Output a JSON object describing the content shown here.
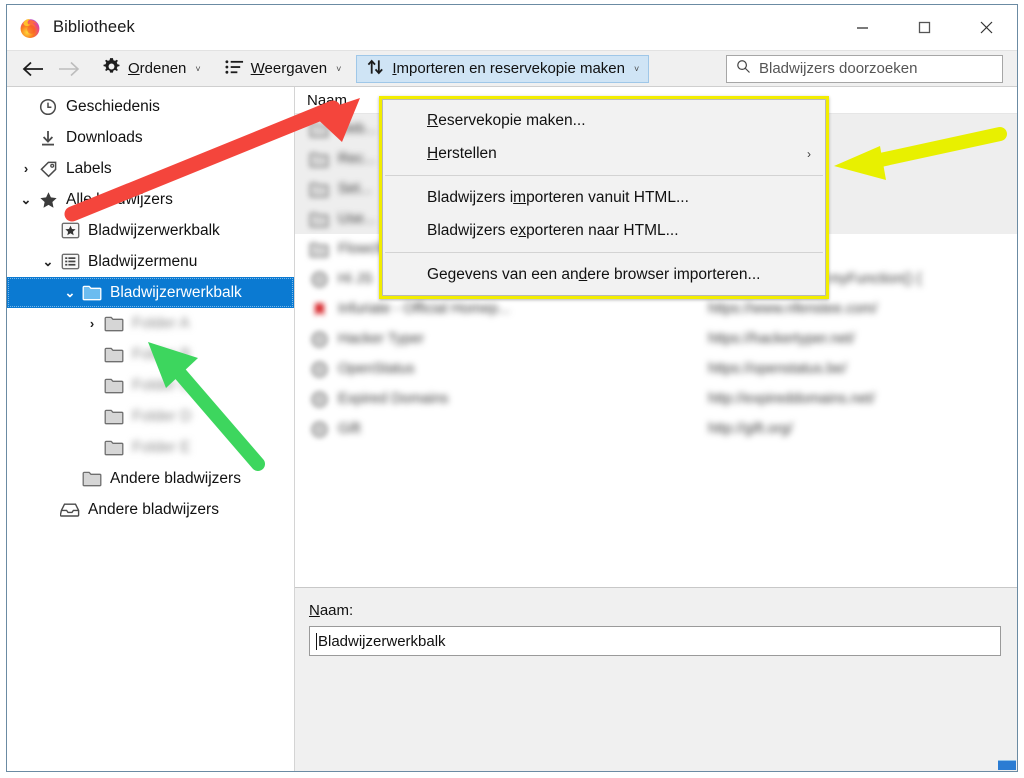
{
  "window": {
    "title": "Bibliotheek",
    "app_icon": "firefox-icon",
    "controls": {
      "minimize_label": "—",
      "maximize_label": "☐",
      "close_label": "✕"
    }
  },
  "toolbar": {
    "back_label": "←",
    "forward_label": "→",
    "organize": {
      "label_pre": "",
      "label_accel": "O",
      "label_post": "rdenen",
      "icon": "gear-icon",
      "caret": "˅"
    },
    "views": {
      "label_pre": "",
      "label_accel": "W",
      "label_post": "eergaven",
      "icon": "views-list-icon",
      "caret": "˅"
    },
    "import": {
      "label_pre": "",
      "label_accel": "I",
      "label_post": "mporteren en reservekopie maken",
      "icon": "import-export-icon",
      "caret": "˅"
    }
  },
  "search": {
    "icon": "search-icon",
    "placeholder": "Bladwijzers doorzoeken",
    "value": ""
  },
  "menu": {
    "border_color": "#f2ed00",
    "items": [
      {
        "pre": "",
        "accel": "R",
        "post": "eservekopie maken...",
        "type": "item",
        "name": "menu-item-backup"
      },
      {
        "pre": "",
        "accel": "H",
        "post": "erstellen",
        "type": "submenu",
        "arrow": "›",
        "name": "menu-item-restore"
      },
      {
        "type": "separator"
      },
      {
        "pre": "Bladwijzers i",
        "accel": "m",
        "post": "porteren vanuit HTML...",
        "type": "item",
        "name": "menu-item-import-html"
      },
      {
        "pre": "Bladwijzers e",
        "accel": "x",
        "post": "porteren naar HTML...",
        "type": "item",
        "name": "menu-item-export-html"
      },
      {
        "type": "separator"
      },
      {
        "pre": "Gegevens van een an",
        "accel": "d",
        "post": "ere browser importeren...",
        "type": "item",
        "name": "menu-item-import-other-browser"
      }
    ]
  },
  "sidebar": {
    "items": [
      {
        "label": "Geschiedenis",
        "icon": "clock-icon",
        "indent": 0,
        "twisty": "",
        "selected": false,
        "blurred": false,
        "name": "sidebar-item-history"
      },
      {
        "label": "Downloads",
        "icon": "download-icon",
        "indent": 0,
        "twisty": "",
        "selected": false,
        "blurred": false,
        "name": "sidebar-item-downloads"
      },
      {
        "label": "Labels",
        "icon": "tag-icon",
        "indent": 0,
        "twisty": "›",
        "selected": false,
        "blurred": false,
        "name": "sidebar-item-tags"
      },
      {
        "label": "Alle bladwijzers",
        "icon": "star-icon",
        "indent": 0,
        "twisty": "⌄",
        "selected": false,
        "blurred": false,
        "name": "sidebar-item-all-bookmarks"
      },
      {
        "label": "Bladwijzerwerkbalk",
        "icon": "star-box-icon",
        "indent": 1,
        "twisty": "",
        "selected": false,
        "blurred": false,
        "name": "sidebar-item-bookmarks-toolbar-top"
      },
      {
        "label": "Bladwijzermenu",
        "icon": "menu-list-icon",
        "indent": 1,
        "twisty": "⌄",
        "selected": false,
        "blurred": false,
        "name": "sidebar-item-bookmarks-menu"
      },
      {
        "label": "Bladwijzerwerkbalk",
        "icon": "folder-blue-icon",
        "indent": 2,
        "twisty": "⌄",
        "selected": true,
        "blurred": false,
        "name": "sidebar-item-bookmarks-toolbar-selected"
      },
      {
        "label": "Folder A",
        "icon": "folder-icon",
        "indent": 3,
        "twisty": "›",
        "selected": false,
        "blurred": true,
        "name": "sidebar-item-folder-1"
      },
      {
        "label": "Folder B",
        "icon": "folder-icon",
        "indent": 3,
        "twisty": "",
        "selected": false,
        "blurred": true,
        "name": "sidebar-item-folder-2"
      },
      {
        "label": "Folder C",
        "icon": "folder-icon",
        "indent": 3,
        "twisty": "",
        "selected": false,
        "blurred": true,
        "name": "sidebar-item-folder-3"
      },
      {
        "label": "Folder D",
        "icon": "folder-icon",
        "indent": 3,
        "twisty": "",
        "selected": false,
        "blurred": true,
        "name": "sidebar-item-folder-4"
      },
      {
        "label": "Folder E",
        "icon": "folder-icon",
        "indent": 3,
        "twisty": "",
        "selected": false,
        "blurred": true,
        "name": "sidebar-item-folder-5"
      },
      {
        "label": "Andere bladwijzers",
        "icon": "folder-icon",
        "indent": 2,
        "twisty": "",
        "selected": false,
        "blurred": false,
        "name": "sidebar-item-other-bookmarks-folder"
      },
      {
        "label": "Andere bladwijzers",
        "icon": "unfiled-icon",
        "indent": 1,
        "twisty": "",
        "selected": false,
        "blurred": false,
        "name": "sidebar-item-other-bookmarks"
      }
    ]
  },
  "list": {
    "column_header": "Naam",
    "rows": [
      {
        "name": "Deb...",
        "url": "",
        "icon": "folder-icon",
        "blurred": true,
        "band": true
      },
      {
        "name": "Rec...",
        "url": "",
        "icon": "folder-icon",
        "blurred": true,
        "band": true
      },
      {
        "name": "Set...",
        "url": "",
        "icon": "folder-icon",
        "blurred": true,
        "band": true
      },
      {
        "name": "Use...",
        "url": "",
        "icon": "folder-icon",
        "blurred": true,
        "band": true
      },
      {
        "name": "Flowcharts",
        "url": "",
        "icon": "folder-icon",
        "blurred": true,
        "band": false
      },
      {
        "name": "Hi JS",
        "url": "javascript:function myFunction() {",
        "icon": "globe-icon",
        "blurred": true,
        "band": false
      },
      {
        "name": "Infuriate - Official Homep...",
        "url": "https://www.nfenstee.com/",
        "icon": "bookmark-red-icon",
        "blurred": true,
        "band": false
      },
      {
        "name": "Hacker Typer",
        "url": "https://hackertyper.net/",
        "icon": "globe-icon",
        "blurred": true,
        "band": false
      },
      {
        "name": "OpenStatus",
        "url": "https://openstatus.be/",
        "icon": "globe-icon",
        "blurred": true,
        "band": false
      },
      {
        "name": "Expired Domains",
        "url": "http://expireddomains.net/",
        "icon": "globe-icon",
        "blurred": true,
        "band": false
      },
      {
        "name": "Gift",
        "url": "http://gift.org/",
        "icon": "globe-icon",
        "blurred": true,
        "band": false
      }
    ]
  },
  "detail": {
    "label_accel": "N",
    "label_post": "aam:",
    "value": "Bladwijzerwerkbalk"
  },
  "annotations": {
    "red_arrow": {
      "color": "#f4453c",
      "direction": "up-right",
      "name": "red-arrow-annotation"
    },
    "yellow_arrow": {
      "color": "#e8f000",
      "direction": "left",
      "name": "yellow-arrow-annotation"
    },
    "green_arrow": {
      "color": "#3dd65e",
      "direction": "up-left",
      "name": "green-arrow-annotation"
    }
  }
}
